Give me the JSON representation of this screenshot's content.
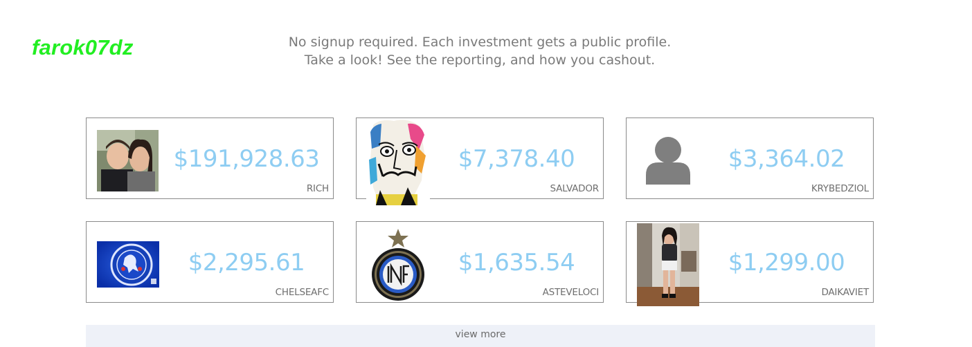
{
  "watermark": "farok07dz",
  "intro": {
    "line1": "No signup required. Each investment gets a public profile.",
    "line2": "Take a look! See the reporting, and how you cashout."
  },
  "cards": [
    {
      "amount": "$191,928.63",
      "username": "RICH",
      "avatar": "couple-photo"
    },
    {
      "amount": "$7,378.40",
      "username": "SALVADOR",
      "avatar": "dali-portrait-painting"
    },
    {
      "amount": "$3,364.02",
      "username": "KRYBEDZIOL",
      "avatar": "default-user-icon"
    },
    {
      "amount": "$2,295.61",
      "username": "CHELSEAFC",
      "avatar": "chelsea-fc-crest"
    },
    {
      "amount": "$1,635.54",
      "username": "ASTEVELOCI",
      "avatar": "inter-milan-crest"
    },
    {
      "amount": "$1,299.00",
      "username": "DAIKAVIET",
      "avatar": "woman-selfie-photo"
    }
  ],
  "view_more_label": "view more",
  "colors": {
    "amount": "#8ecdf2",
    "watermark": "#22ee22",
    "intro_text": "#7a7a7a",
    "view_more_bg": "#eef1f8"
  }
}
